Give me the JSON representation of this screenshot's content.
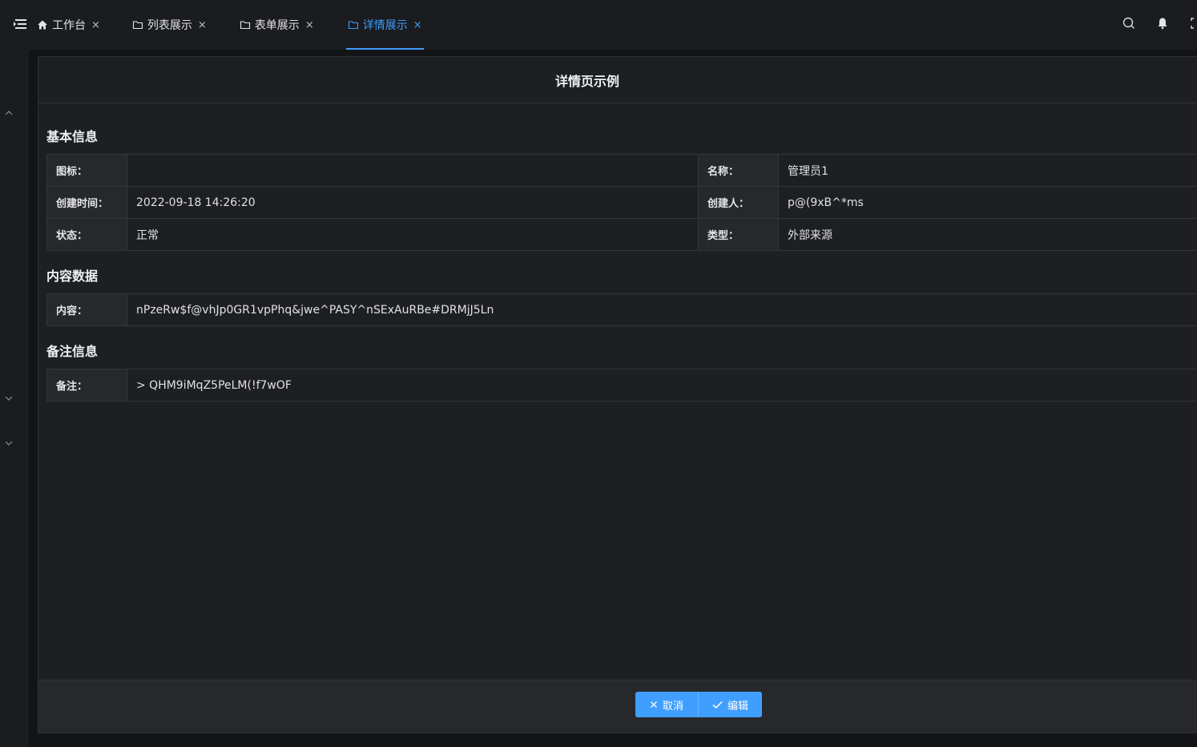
{
  "tabs": [
    {
      "label": "工作台",
      "icon": "home-icon",
      "active": false
    },
    {
      "label": "列表展示",
      "icon": "folder-icon",
      "active": false
    },
    {
      "label": "表单展示",
      "icon": "folder-icon",
      "active": false
    },
    {
      "label": "详情展示",
      "icon": "folder-icon",
      "active": true
    }
  ],
  "close_glyph": "×",
  "page_title": "详情页示例",
  "sections": {
    "basic": {
      "title": "基本信息",
      "rows": [
        {
          "l1": "图标：",
          "v1": "",
          "l2": "名称：",
          "v2": "管理员1"
        },
        {
          "l1": "创建时间：",
          "v1": "2022-09-18 14:26:20",
          "l2": "创建人：",
          "v2": "p@(9xB^*ms"
        },
        {
          "l1": "状态：",
          "v1": "正常",
          "l2": "类型：",
          "v2": "外部来源"
        }
      ]
    },
    "content": {
      "title": "内容数据",
      "label": "内容：",
      "value": "nPzeRw$f@vhJp0GR1vpPhq&jwe^PASY^nSExAuRBe#DRMjJ5Ln"
    },
    "remark": {
      "title": "备注信息",
      "label": "备注：",
      "value": "> QHM9iMqZ5PeLM(!f7wOF"
    }
  },
  "buttons": {
    "cancel": "取消",
    "edit": "编辑"
  },
  "colors": {
    "accent": "#409eff",
    "background": "#1e1f23"
  }
}
